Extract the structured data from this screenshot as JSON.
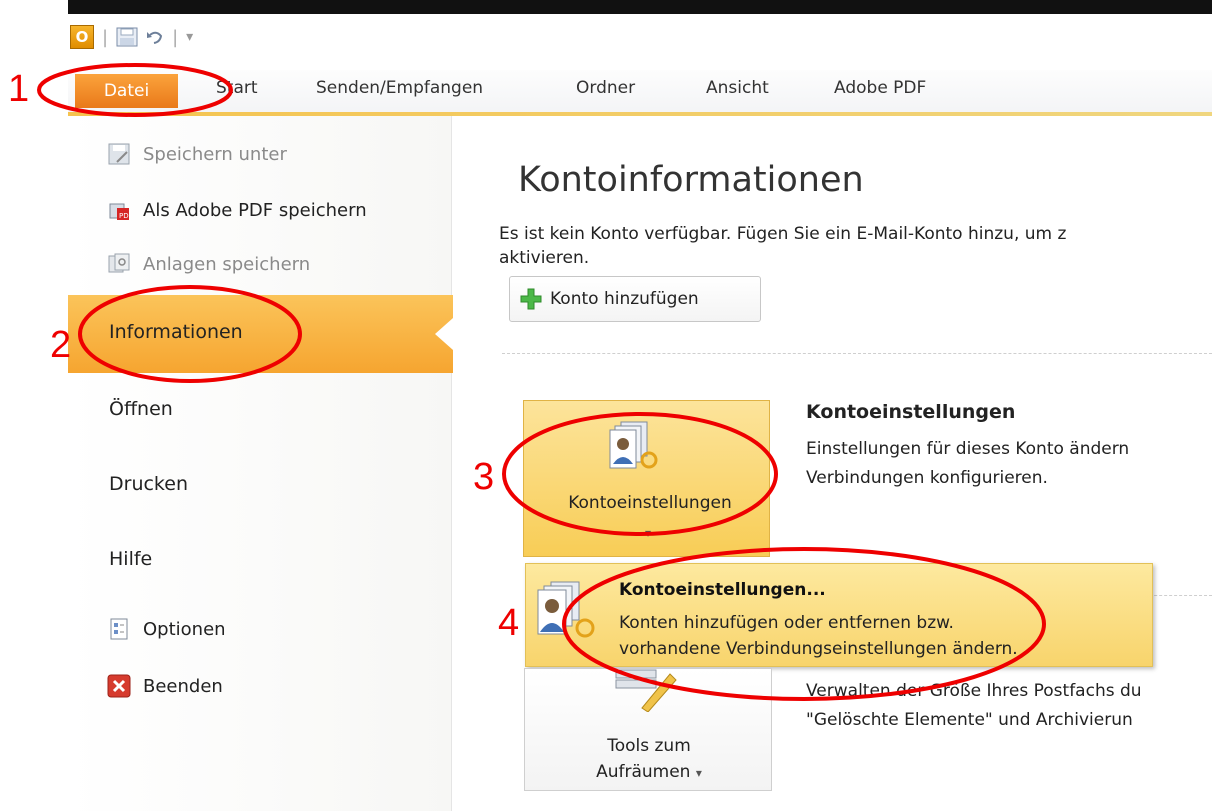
{
  "ribbon": {
    "tabs": [
      "Datei",
      "Start",
      "Senden/Empfangen",
      "Ordner",
      "Ansicht",
      "Adobe PDF"
    ]
  },
  "backstage": {
    "menu": [
      {
        "label": "Speichern unter",
        "icon": "save-as-icon",
        "disabled": true
      },
      {
        "label": "Als Adobe PDF speichern",
        "icon": "adobe-pdf-icon",
        "disabled": false
      },
      {
        "label": "Anlagen speichern",
        "icon": "attachments-icon",
        "disabled": true
      },
      {
        "label": "Informationen",
        "active": true
      },
      {
        "label": "Öffnen"
      },
      {
        "label": "Drucken"
      },
      {
        "label": "Hilfe"
      },
      {
        "label": "Optionen",
        "icon": "options-icon"
      },
      {
        "label": "Beenden",
        "icon": "exit-icon"
      }
    ]
  },
  "main": {
    "title": "Kontoinformationen",
    "desc_line1": "Es ist kein Konto verfügbar. Fügen Sie ein E-Mail-Konto hinzu, um z",
    "desc_line2": "aktivieren.",
    "add_account_label": "Konto hinzufügen",
    "account_settings": {
      "button_label": "Kontoeinstellungen",
      "heading": "Kontoeinstellungen",
      "desc_line1": "Einstellungen für dieses Konto ändern",
      "desc_line2": "Verbindungen konfigurieren."
    },
    "dropdown_item": {
      "title": "Kontoeinstellungen...",
      "desc_line1": "Konten hinzufügen oder entfernen bzw.",
      "desc_line2": "vorhandene Verbindungseinstellungen ändern."
    },
    "cleanup": {
      "label_line1": "Tools zum",
      "label_line2": "Aufräumen",
      "desc_line1": "Verwalten der Größe Ihres Postfachs du",
      "desc_line2": "\"Gelöschte Elemente\" und Archivierun"
    }
  },
  "annotations": [
    "1",
    "2",
    "3",
    "4"
  ],
  "colors": {
    "file_tab": "#ef8a22",
    "active_item": "#f8b544",
    "annotation": "#e00000"
  }
}
